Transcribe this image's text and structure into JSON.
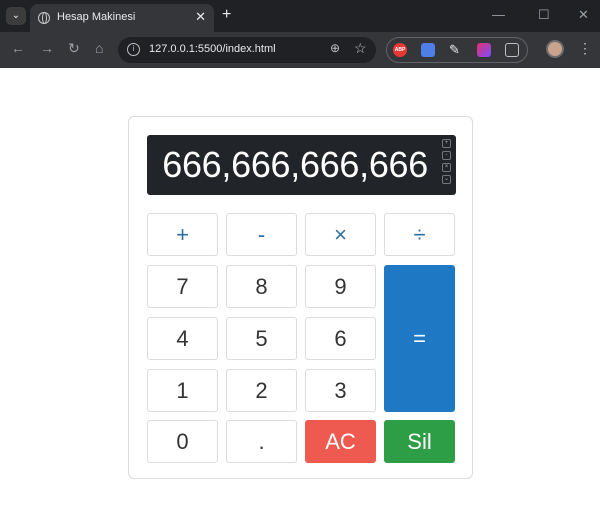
{
  "browser": {
    "tab_title": "Hesap Makinesi",
    "tab_close": "✕",
    "new_tab": "+",
    "url": "127.0.0.1:5500/index.html",
    "extension_label": "ABP"
  },
  "calculator": {
    "display": "666,666,666,666",
    "buttons": {
      "plus": "+",
      "minus": "-",
      "multiply": "×",
      "divide": "÷",
      "seven": "7",
      "eight": "8",
      "nine": "9",
      "four": "4",
      "five": "5",
      "six": "6",
      "one": "1",
      "two": "2",
      "three": "3",
      "zero": "0",
      "dot": ".",
      "equals": "=",
      "clear": "AC",
      "delete": "Sil"
    }
  },
  "colors": {
    "display_bg": "#212529",
    "equals": "#1f78c4",
    "clear": "#ef5a50",
    "delete": "#2e9e46",
    "operator_text": "#2f6fa0"
  },
  "icons": [
    "tab-search-icon",
    "globe-icon",
    "close-icon",
    "back-icon",
    "forward-icon",
    "reload-icon",
    "home-icon",
    "site-info-icon",
    "zoom-icon",
    "star-icon",
    "extensions-icon",
    "avatar",
    "menu-icon"
  ]
}
